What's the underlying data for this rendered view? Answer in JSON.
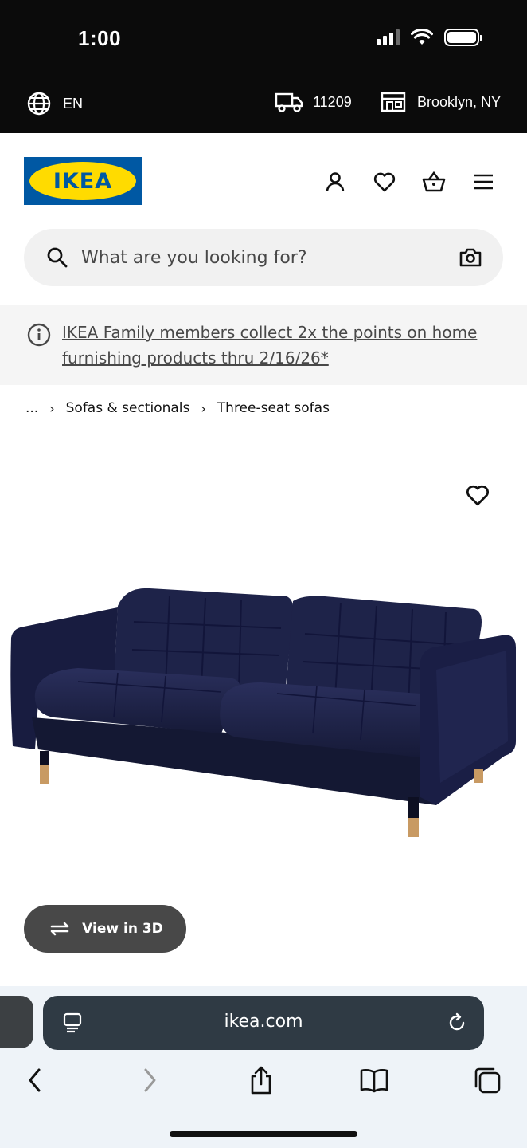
{
  "status_bar": {
    "time": "1:00"
  },
  "locale": {
    "language": "EN",
    "zip": "11209",
    "store": "Brooklyn, NY"
  },
  "brand": {
    "logo_text": "IKEA",
    "colors": {
      "blue": "#0058a3",
      "yellow": "#ffdb00"
    }
  },
  "header_icons": [
    "user-icon",
    "heart-icon",
    "basket-icon",
    "menu-icon"
  ],
  "search": {
    "placeholder": "What are you looking for?"
  },
  "banner": {
    "text": "IKEA Family members collect 2x the points on home furnishing products thru 2/16/26*"
  },
  "breadcrumb": {
    "ellipsis": "...",
    "items": [
      "Sofas & sectionals",
      "Three-seat sofas"
    ]
  },
  "product": {
    "view3d_label": "View in 3D",
    "sofa_color": "#1c2145"
  },
  "browser": {
    "url": "ikea.com"
  }
}
